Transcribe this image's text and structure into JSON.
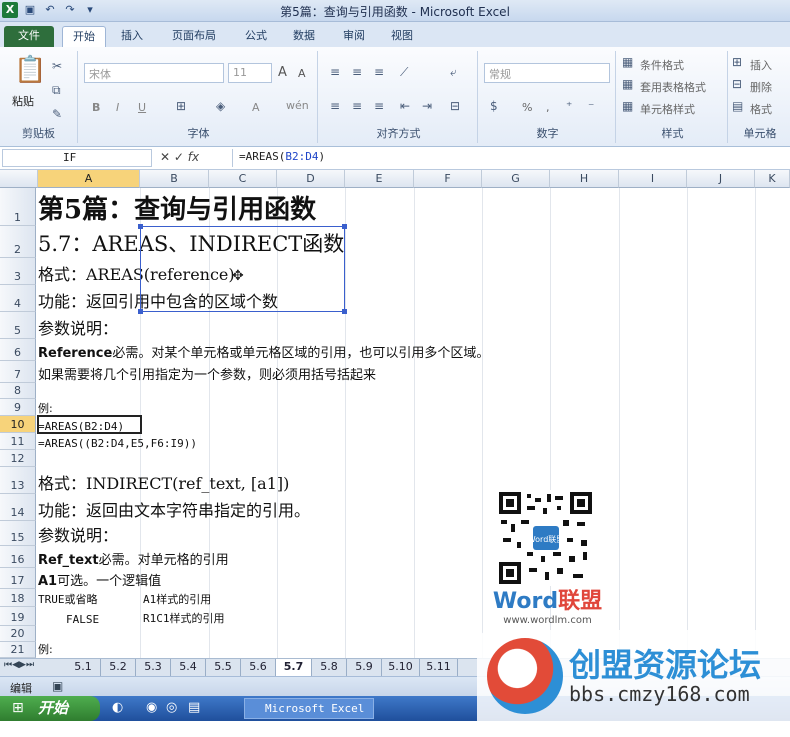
{
  "window": {
    "title": "第5篇：查询与引用函数 - Microsoft Excel"
  },
  "qat": {
    "icons": [
      "excel-icon",
      "save-icon",
      "undo-icon",
      "redo-icon",
      "customize-icon"
    ]
  },
  "tabs": [
    "文件",
    "开始",
    "插入",
    "页面布局",
    "公式",
    "数据",
    "审阅",
    "视图"
  ],
  "ribbon": {
    "clipboard": {
      "label": "剪贴板",
      "paste": "粘贴"
    },
    "font": {
      "label": "字体",
      "name": "宋体",
      "size": "11",
      "bold": "B",
      "italic": "I",
      "underline": "U",
      "grow": "A",
      "shrink": "A",
      "color": "A",
      "wen": "wén"
    },
    "align": {
      "label": "对齐方式"
    },
    "number": {
      "label": "数字",
      "format": "常规",
      "percent": "%",
      ",": ","
    },
    "styles": {
      "label": "样式",
      "cond": "条件格式",
      "table": "套用表格格式",
      "cell": "单元格样式"
    },
    "cells": {
      "label": "单元格",
      "insert": "插入",
      "delete": "删除",
      "format": "格式"
    }
  },
  "formula_bar": {
    "name_box": "IF",
    "fx": "fx",
    "prefix": "=AREAS(",
    "range": "B2:D4",
    "suffix": ")"
  },
  "columns": [
    "A",
    "B",
    "C",
    "D",
    "E",
    "F",
    "G",
    "H",
    "I",
    "J",
    "K"
  ],
  "rows": [
    "1",
    "2",
    "3",
    "4",
    "5",
    "6",
    "7",
    "8",
    "9",
    "10",
    "11",
    "12",
    "13",
    "14",
    "15",
    "16",
    "17",
    "18",
    "19",
    "20",
    "21"
  ],
  "cells": {
    "r1": "第5篇：查询与引用函数",
    "r2": "5.7：AREAS、INDIRECT函数",
    "r3": "格式：AREAS(reference)",
    "r4": "功能：返回引用中包含的区域个数",
    "r5": "参数说明：",
    "r6a": "Reference",
    "r6b": " 必需。对某个单元格或单元格区域的引用，也可以引用多个区域。",
    "r7": "如果需要将几个引用指定为一个参数，则必须用括号括起来",
    "r9": "例:",
    "r10": "=AREAS(B2:D4)",
    "r11": "=AREAS((B2:D4,E5,F6:I9))",
    "r13": "格式：INDIRECT(ref_text, [a1])",
    "r14": "功能：返回由文本字符串指定的引用。",
    "r15": "参数说明：",
    "r16a": "Ref_text",
    "r16b": " 必需。对单元格的引用",
    "r17a": "A1",
    "r17b": " 可选。一个逻辑值",
    "r18a": "TRUE或省略",
    "r18b": "A1样式的引用",
    "r19a": "FALSE",
    "r19b": "R1C1样式的引用",
    "r21": "例:"
  },
  "sheet_tabs": [
    "5.1",
    "5.2",
    "5.3",
    "5.4",
    "5.5",
    "5.6",
    "5.7",
    "5.8",
    "5.9",
    "5.10",
    "5.11"
  ],
  "status": {
    "mode": "编辑"
  },
  "taskbar": {
    "start": "开始",
    "excel": "Microsoft Excel ..."
  },
  "watermark": {
    "brand1": "Word",
    "brand2": "联盟",
    "brand_url": "www.wordlm.com",
    "site": "创盟资源论坛",
    "site_url": "bbs.cmzy168.com",
    "qr_text": "Word联盟"
  }
}
